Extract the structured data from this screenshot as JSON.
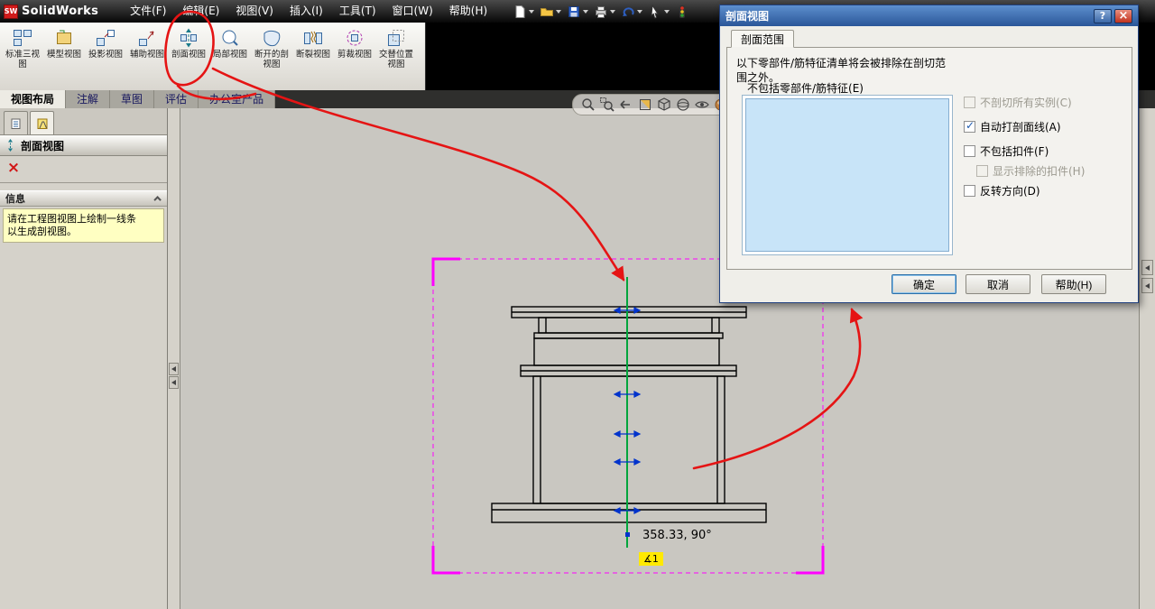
{
  "title_bar": {
    "logo_text": "SW",
    "app_name": "SolidWorks",
    "menus": [
      "文件(F)",
      "编辑(E)",
      "视图(V)",
      "插入(I)",
      "工具(T)",
      "窗口(W)",
      "帮助(H)"
    ]
  },
  "command_bar": {
    "buttons": [
      {
        "label": "标准三视图"
      },
      {
        "label": "模型视图"
      },
      {
        "label": "投影视图"
      },
      {
        "label": "辅助视图"
      },
      {
        "label": "剖面视图"
      },
      {
        "label": "局部视图"
      },
      {
        "label": "断开的剖视图"
      },
      {
        "label": "断裂视图"
      },
      {
        "label": "剪裁视图"
      },
      {
        "label": "交替位置视图"
      }
    ]
  },
  "tab_bar": {
    "tabs": [
      {
        "label": "视图布局",
        "active": true
      },
      {
        "label": "注解",
        "active": false
      },
      {
        "label": "草图",
        "active": false
      },
      {
        "label": "评估",
        "active": false
      },
      {
        "label": "办公室产品",
        "active": false
      }
    ]
  },
  "left_panel": {
    "header_title": "剖面视图",
    "info_title": "信息",
    "info_message_line1": "请在工程图视图上绘制一线条",
    "info_message_line2": "以生成剖视图。"
  },
  "drawing": {
    "dimension_text": "358.33, 90°",
    "section_tag": "∡1"
  },
  "dialog": {
    "title": "剖面视图",
    "tab_label": "剖面范围",
    "description_line1": "以下零部件/筋特征清单将会被排除在剖切范",
    "description_line2": "围之外。",
    "list_label": "不包括零部件/筋特征(E)",
    "checkboxes": [
      {
        "label": "不剖切所有实例(C)",
        "checked": false,
        "disabled": true
      },
      {
        "label": "自动打剖面线(A)",
        "checked": true,
        "disabled": false
      },
      {
        "label": "不包括扣件(F)",
        "checked": false,
        "disabled": false
      },
      {
        "label": "显示排除的扣件(H)",
        "checked": false,
        "disabled": true
      },
      {
        "label": "反转方向(D)",
        "checked": false,
        "disabled": false
      }
    ],
    "ok_label": "确定",
    "cancel_label": "取消",
    "help_label": "帮助(H)"
  },
  "colors": {
    "selection_magenta": "#FF00FF",
    "section_line_green": "#00A53C",
    "sketch_blue": "#0033CC",
    "annotation_red": "#E51414",
    "info_yellow": "#FFFFC2",
    "tag_yellow": "#FFE900"
  }
}
